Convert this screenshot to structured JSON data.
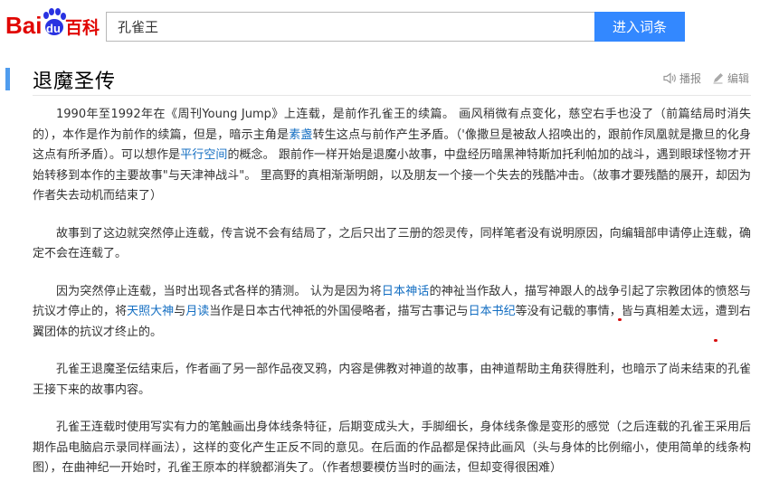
{
  "header": {
    "logo": {
      "part1": "Bai",
      "part2": "du",
      "part3": "百科",
      "paw_color": "#2932e1",
      "text_color": "#e10602"
    },
    "search": {
      "value": "孔雀王",
      "placeholder": ""
    },
    "search_button_label": "进入词条"
  },
  "section": {
    "title": "退魔圣传",
    "tools": [
      {
        "icon": "audio-icon",
        "label": ""
      },
      {
        "icon": "report-icon",
        "label": "播报"
      },
      {
        "icon": "edit-icon",
        "label": "编辑"
      }
    ]
  },
  "paragraphs": [
    {
      "t1": "1990年至1992年在《周刊Young Jump》上连载，是前作孔雀王的续篇。 画风稍微有点变化，慈空右手也没了（前篇结局时消失的），本作是作为前作的续篇，但是，暗示主角是",
      "link1": "素盏",
      "t2": "转生这点与前作产生矛盾。（'像撒旦是被敌人招唤出的，跟前作凤凰就是撒旦的化身这点有所矛盾）。可以想作是",
      "link2": "平行空间",
      "t3": "的概念。 跟前作一样开始是退魔小故事，中盘经历暗黑神特斯加托利帕加的战斗，遇到眼球怪物才开始转移到本作的主要故事\"与天津神战斗\"。 里高野的真相渐渐明朗，以及朋友一个接一个失去的残酷冲击。（故事才要残酷的展开，却因为作者失去动机而结束了）"
    },
    {
      "t1": "故事到了这边就突然停止连载，传言说不会有结局了，之后只出了三册的怨灵传，同样笔者没有说明原因，向编辑部申请停止连载，确定不会在连载了。"
    },
    {
      "t1": "因为突然停止连载，当时出现各式各样的猜测。 认为是因为将",
      "link1": "日本神话",
      "t2": "的神祉当作敌人，描写神跟人的战争",
      "u1": "引起了宗教团体的愤怒与抗议才停止的",
      "t3": "，将",
      "link2": "天照大神",
      "t4": "与",
      "link3": "月读",
      "t5": "当作是日本古代神祇的外国侵略者，描写古事记与",
      "link4": "日本书纪",
      "t6": "等没有记载的事情，皆与真相差太远，",
      "u2": "遭到右翼团体的抗议才终止的",
      "t7": "。"
    },
    {
      "t1": "孔雀王退魔圣伝结束后，作者画了另一部作品夜叉鸦，内容是佛教对神道的故事，由神道帮助主角获得胜利，也暗示了尚未结束的孔雀王接下来的故事内容。"
    },
    {
      "t1": "孔雀王连载时使用写实有力的笔触画出身体线条特征，后期变成头大，手脚细长，身体线条像是变形的感觉（之后连载的孔雀王采用后期作品电脑启示录同样画法），这样的变化产生正反不同的意见。在后面的作品都是保持此画风（头与身体的比例缩小，使用简单的线条构图），在曲神纪一开始时，孔雀王原本的样貌都消失了。（作者想要模仿当时的画法，但却变得很困难）"
    }
  ],
  "colors": {
    "accent": "#3388ff",
    "link": "#136ec2",
    "underline_mark": "#d80f0f",
    "title_bar": "#4f9cee"
  }
}
